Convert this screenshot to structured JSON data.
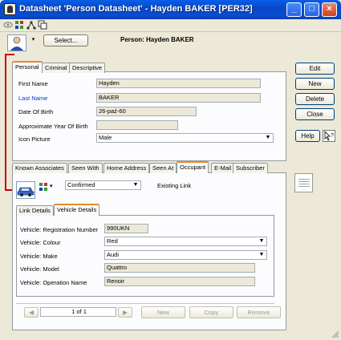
{
  "window": {
    "title": "Datasheet 'Person Datasheet' - Hayden BAKER [PER32]",
    "minimize": "_",
    "maximize": "□",
    "close": "×"
  },
  "header": {
    "select_label": "Select...",
    "person_title": "Person: Hayden BAKER"
  },
  "person_tabs": [
    "Personal",
    "Criminal",
    "Descriptive"
  ],
  "person": {
    "first_name_label": "First Name",
    "first_name": "Hayden",
    "last_name_label": "Last Name",
    "last_name": "BAKER",
    "dob_label": "Date Of Birth",
    "dob": "26-paź-60",
    "approx_year_label": "Approximate Year Of Birth",
    "approx_year": "",
    "icon_picture_label": "Icon Picture",
    "icon_picture": "Male"
  },
  "side_buttons": {
    "edit": "Edit",
    "new": "New",
    "delete": "Delete",
    "close": "Close",
    "help": "Help"
  },
  "link_tabs": [
    "Known Associates",
    "Seen With",
    "Home Address",
    "Seen At",
    "Occupant",
    "E-Mail",
    "Subscriber"
  ],
  "link": {
    "status": "Confirmed",
    "existing_label": "Existing Link"
  },
  "detail_tabs": [
    "Link Details",
    "Vehicle Details"
  ],
  "vehicle": {
    "reg_label": "Vehicle: Registration Number",
    "reg": "990UKN",
    "colour_label": "Vehicle: Colour",
    "colour": "Red",
    "make_label": "Vehicle: Make",
    "make": "Audi",
    "model_label": "Vehicle: Model",
    "model": "Quattro",
    "operation_label": "Vehicle: Operation Name",
    "operation": "Renoir"
  },
  "nav": {
    "page": "1 of 1",
    "new": "New",
    "copy": "Copy",
    "remove": "Remove"
  }
}
